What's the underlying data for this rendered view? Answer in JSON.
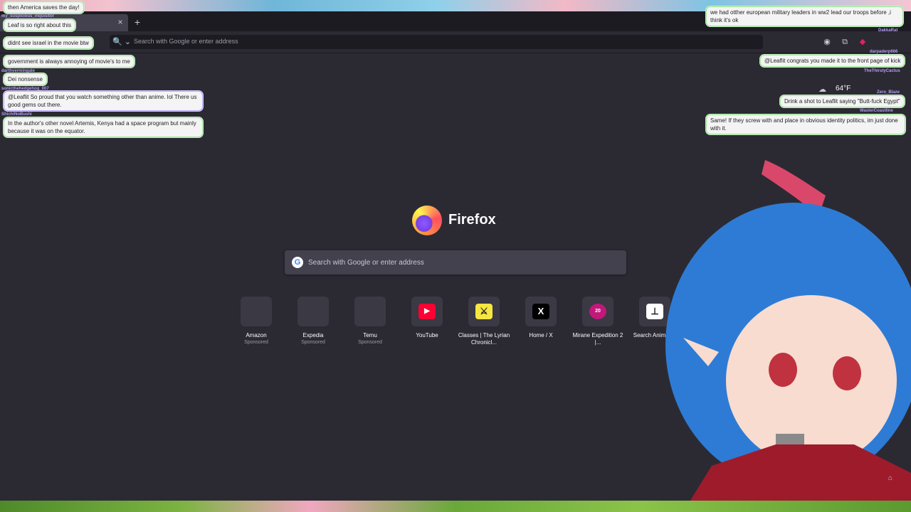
{
  "browser": {
    "new_tab_symbol": "+",
    "close_symbol": "×",
    "url_placeholder": "Search with Google or enter address",
    "search_engine_glyph": "🔍 ⌄"
  },
  "newtab": {
    "brand": "Firefox",
    "search_placeholder": "Search with Google or enter address",
    "tiles": [
      {
        "title": "Amazon",
        "subtitle": "Sponsored"
      },
      {
        "title": "Expedia",
        "subtitle": "Sponsored"
      },
      {
        "title": "Temu",
        "subtitle": "Sponsored"
      },
      {
        "title": "YouTube",
        "subtitle": ""
      },
      {
        "title": "Classes | The Lyrian Chronicl...",
        "subtitle": ""
      },
      {
        "title": "Home / X",
        "subtitle": ""
      },
      {
        "title": "Mirane Expedition 2 |...",
        "subtitle": ""
      },
      {
        "title": "Search AnimeT...",
        "subtitle": ""
      }
    ],
    "weather": "64°F"
  },
  "chat_left": [
    {
      "user": "",
      "text": "then America saves the day!"
    },
    {
      "user": "my_suspicious_inquisitor",
      "text": "Leaf is so right about this"
    },
    {
      "user": "",
      "text": "didnt see israel in the movie btw"
    },
    {
      "user": "",
      "text": "government is always annoying of movie's to me"
    },
    {
      "user": "darthvermingate",
      "text": "Dei nonsense"
    },
    {
      "user": "sonicthehedgehog_007",
      "text": "@Leaflit So proud that you watch something other than anime. lol There us good gems out there."
    },
    {
      "user": "ShichiNoBushi",
      "text": "In the author's other novel Artemis, Kenya had a space program but mainly because it was on the equator."
    }
  ],
  "chat_right": [
    {
      "user": "",
      "text": "we had otther european military leaders in ww2 lead our troops before ,i think it's ok"
    },
    {
      "user": "DakkaRat",
      "text": ""
    },
    {
      "user": "darpaderp666",
      "text": "@Leaflit congrats you made it to the front page of kick"
    },
    {
      "user": "TheThirstyCactus",
      "text": ""
    },
    {
      "user": "Zero_Blaze",
      "text": "Drink a shot to Leaflit saying \"Butt-fuck Egypt\""
    },
    {
      "user": "WasterCoastline",
      "text": "Same! If they screw with and place in obvious identity politics, im just done with it."
    }
  ],
  "colors": {
    "accent_youtube": "#ff0033",
    "accent_mirane": "#c2187a",
    "classes_tile_bg": "#f5e642"
  }
}
